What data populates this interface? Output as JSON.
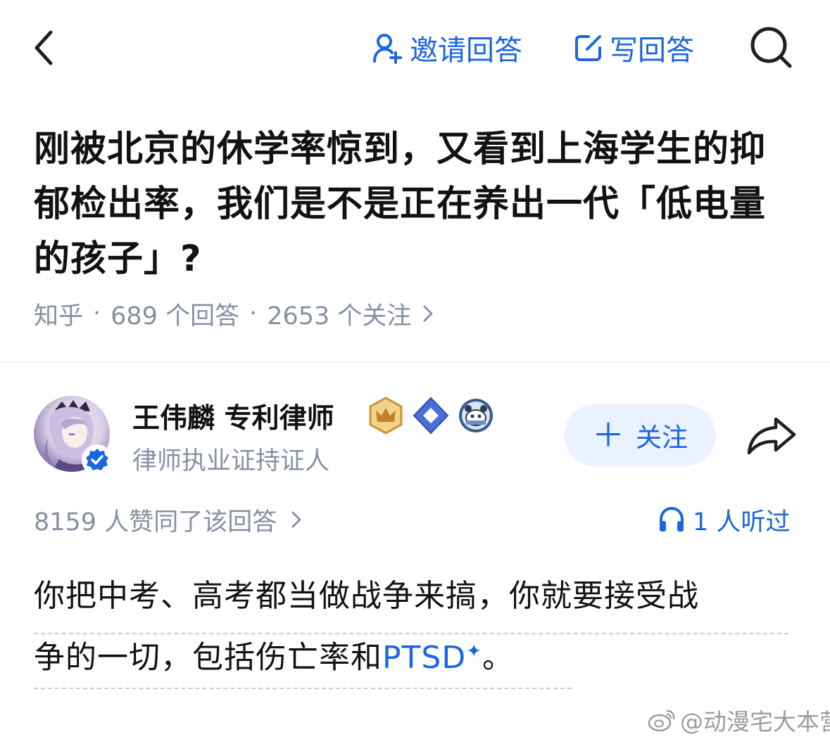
{
  "nav": {
    "invite_label": "邀请回答",
    "write_label": "写回答"
  },
  "question": {
    "title": "刚被北京的休学率惊到，又看到上海学生的抑郁检出率，我们是不是正在养出一代「低电量的孩子」?",
    "source": "知乎",
    "answers_count": "689 个回答",
    "followers_count": "2653 个关注"
  },
  "author": {
    "name": "王伟麟 专利律师",
    "subtitle": "律师执业证持证人",
    "follow_label": "关注",
    "badges": [
      "crown-badge-icon",
      "diamond-badge-icon",
      "panda-badge-icon"
    ]
  },
  "stats": {
    "upvote_text": "8159 人赞同了该回答",
    "listen_text": "1 人听过"
  },
  "answer": {
    "line1": "你把中考、高考都当做战争来搞，你就要接受战",
    "line2_pre": "争的一切，包括伤亡率和",
    "line2_link": "PTSD",
    "line2_link_mark": "✦",
    "line2_post": "。"
  },
  "watermark": "@动漫宅大本营",
  "colors": {
    "accent": "#1a66e0",
    "meta_gray": "#8590a6",
    "text": "#121212",
    "follow_bg": "#ebf2ff"
  }
}
